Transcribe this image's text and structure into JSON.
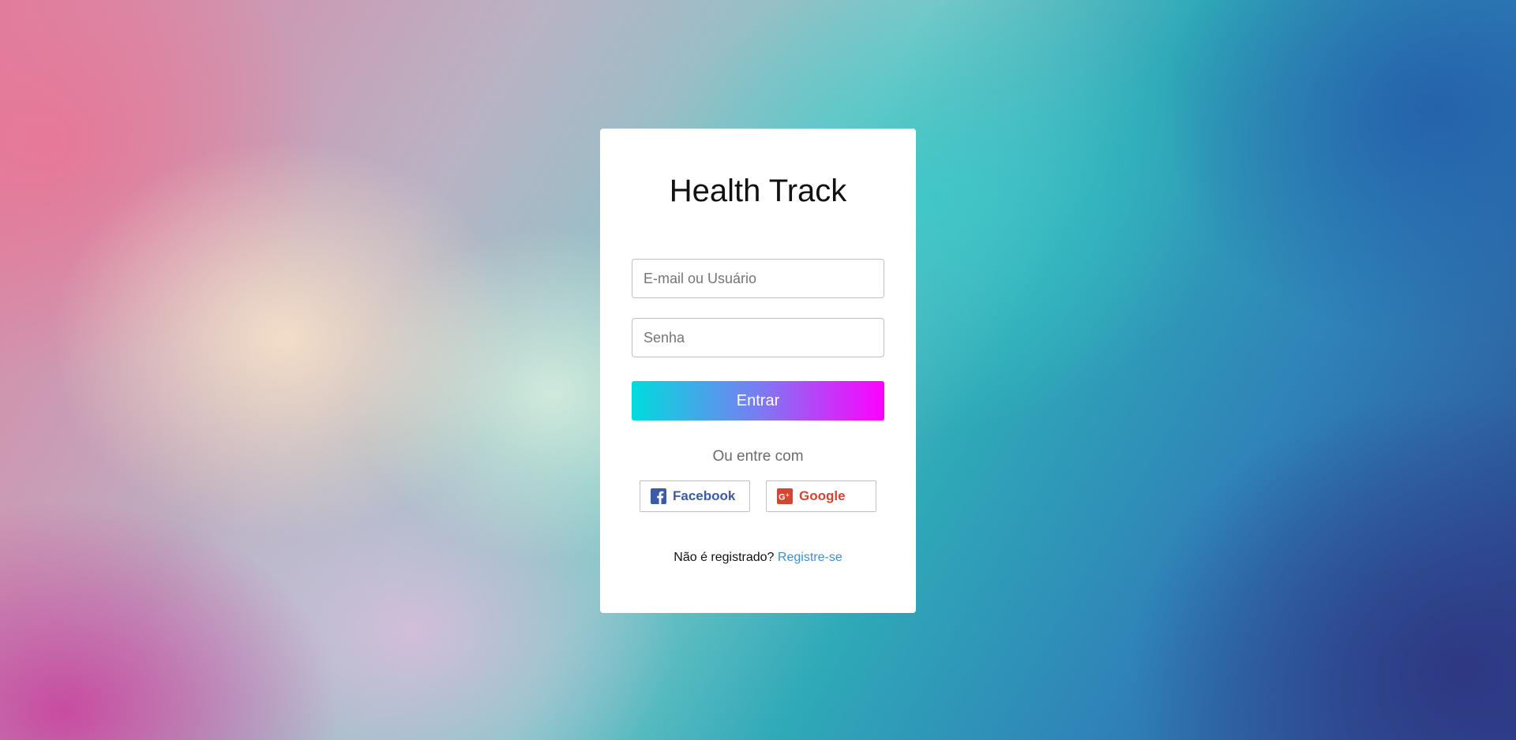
{
  "app": {
    "title": "Health Track"
  },
  "form": {
    "email_placeholder": "E-mail ou Usuário",
    "email_value": "",
    "password_placeholder": "Senha",
    "password_value": "",
    "submit_label": "Entrar",
    "submit_gradient": [
      "#00dcde",
      "#ff00ff"
    ]
  },
  "social": {
    "divider_text": "Ou entre com",
    "facebook": {
      "label": "Facebook",
      "icon": "facebook-icon",
      "color": "#3b5ba9"
    },
    "google": {
      "label": "Google",
      "icon": "google-plus-icon",
      "color": "#d64532"
    }
  },
  "register": {
    "prompt": "Não é registrado?",
    "link_label": "Registre-se",
    "link_color": "#3a8fd6"
  }
}
